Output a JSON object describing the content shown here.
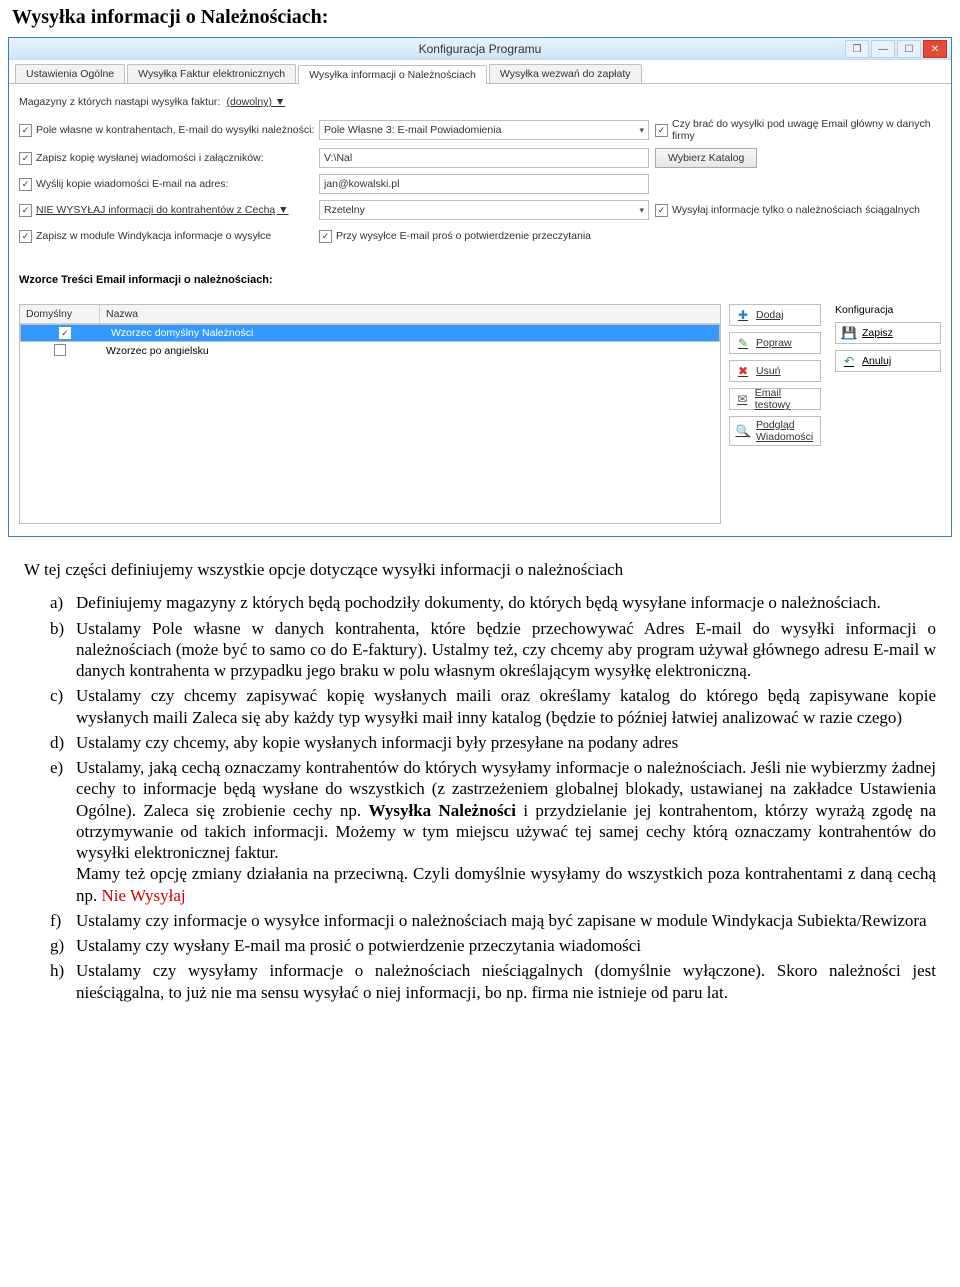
{
  "page_title": "Wysyłka informacji o Należnościach:",
  "window": {
    "title": "Konfiguracja Programu"
  },
  "tabs": {
    "t0": "Ustawienia Ogólne",
    "t1": "Wysyłka Faktur elektronicznych",
    "t2": "Wysyłka informacji o Należnościach",
    "t3": "Wysyłka wezwań do zapłaty"
  },
  "form": {
    "magazyny_label": "Magazyny z których nastąpi wysyłka faktur:",
    "magazyny_value": "(dowolny) ▼",
    "row1_label": "Pole własne w kontrahentach, E-mail do wysyłki należności:",
    "row1_sel": "Pole Własne 3: E-mail Powiadomienia",
    "row1_chk": "Czy brać do wysyłki pod uwagę Email główny w danych firmy",
    "row2_label": "Zapisz kopię wysłanej wiadomości i załączników:",
    "row2_val": "V:\\Nal",
    "row2_btn": "Wybierz Katalog",
    "row3_label": "Wyślij kopie wiadomości E-mail na adres:",
    "row3_val": "jan@kowalski.pl",
    "row4_label": "NIE WYSYŁAJ informacji do kontrahentów z Cechą ▼",
    "row4_sel": "Rzetelny",
    "row4_chk": "Wysyłaj informacje tylko o należnościach ściągalnych",
    "row5_label": "Zapisz w module Windykacja informacje o wysyłce",
    "row5_chk": "Przy wysyłce E-mail proś o potwierdzenie przeczytania"
  },
  "section_label": "Wzorce Treści Email informacji o należnościach:",
  "table": {
    "col1": "Domyślny",
    "col2": "Nazwa",
    "r1": "Wzorzec domyślny Należności",
    "r2": "Wzorzec po angielsku"
  },
  "listbtn": {
    "add": "Dodaj",
    "edit": "Popraw",
    "del": "Usuń",
    "mail": "Email testowy",
    "prev": "Podgląd Wiadomości"
  },
  "side": {
    "label": "Konfiguracja",
    "save": "Zapisz",
    "cancel": "Anuluj"
  },
  "body": {
    "intro": "W tej części definiujemy wszystkie opcje dotyczące wysyłki informacji o należnościach",
    "a": "Definiujemy magazyny z których będą pochodziły dokumenty, do których będą wysyłane informacje o należnościach.",
    "b": "Ustalamy Pole własne w danych kontrahenta, które będzie przechowywać Adres E-mail do wysyłki informacji o należnościach (może być to samo co do E-faktury). Ustalmy też, czy chcemy aby program używał głównego adresu E-mail w danych kontrahenta w przypadku jego braku w polu własnym określającym wysyłkę elektroniczną.",
    "c": "Ustalamy czy chcemy zapisywać kopię wysłanych maili oraz określamy katalog do którego będą zapisywane kopie wysłanych maili Zaleca się aby każdy typ wysyłki maił inny katalog (będzie to później łatwiej analizować w razie czego)",
    "d": "Ustalamy czy chcemy, aby kopie wysłanych informacji były przesyłane na podany adres",
    "e1": "Ustalamy, jaką cechą oznaczamy kontrahentów do których wysyłamy informacje o należnościach. Jeśli nie wybierzmy żadnej cechy to informacje będą wysłane do wszystkich (z zastrzeżeniem globalnej blokady, ustawianej na zakładce Ustawienia Ogólne). Zaleca się zrobienie cechy np. ",
    "e_bold": "Wysyłka Należności",
    "e2": " i przydzielanie jej kontrahentom, którzy wyrażą zgodę na otrzymywanie od takich informacji. Możemy w tym miejscu używać tej samej cechy którą oznaczamy kontrahentów do wysyłki elektronicznej faktur.",
    "e3": "Mamy też opcję zmiany działania na przeciwną. Czyli domyślnie wysyłamy do wszystkich poza kontrahentami z daną cechą np. ",
    "e_red": "Nie Wysyłaj",
    "f": "Ustalamy czy informacje o wysyłce informacji o należnościach mają być zapisane w module Windykacja Subiekta/Rewizora",
    "g": "Ustalamy czy wysłany E-mail ma prosić o potwierdzenie przeczytania wiadomości",
    "h": "Ustalamy czy wysyłamy informacje o należnościach nieściągalnych (domyślnie wyłączone). Skoro należności jest nieściągalna, to już nie ma sensu wysyłać o niej informacji, bo np. firma nie istnieje od paru lat."
  }
}
